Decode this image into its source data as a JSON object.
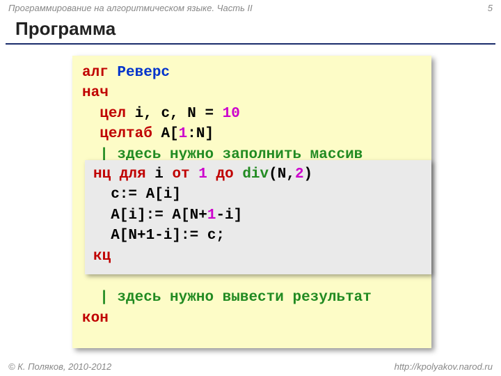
{
  "header": {
    "course": "Программирование на алгоритмическом языке. Часть II",
    "page": "5"
  },
  "title": "Программа",
  "code": {
    "l1_alg": "алг ",
    "l1_name": "Реверс",
    "l2": "нач",
    "l3_kw": "цел",
    "l3_rest": " i, c, N = ",
    "l3_num": "10",
    "l4_kw": "целтаб",
    "l4_rest": " A[",
    "l4_num": "1",
    "l4_rest2": ":N]",
    "l5": "| здесь нужно заполнить массив ",
    "l6": "| здесь нужно вывести результат ",
    "l7": "кон"
  },
  "inset": {
    "l1_nc": "нц для",
    "l1_a": " i ",
    "l1_ot": "от",
    "l1_b": " ",
    "l1_num1": "1",
    "l1_c": " ",
    "l1_do": "до",
    "l1_d": " ",
    "l1_div": "div",
    "l1_e": "(N,",
    "l1_num2": "2",
    "l1_f": ")",
    "l2": "  c:= A[i]",
    "l3a": "  A[i]:= A[N+",
    "l3n": "1",
    "l3b": "-i]",
    "l4a": "  A[N+1-i]:= c;",
    "l5": "кц"
  },
  "footer": {
    "copyright": "© К. Поляков, 2010-2012",
    "url": "http://kpolyakov.narod.ru"
  }
}
